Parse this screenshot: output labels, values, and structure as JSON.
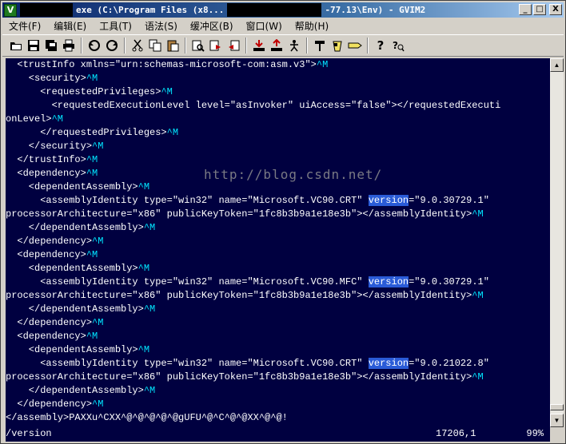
{
  "window": {
    "title_left": "exe (C:\\Program Files (x8...",
    "title_right": "-77.13\\Env) - GVIM2",
    "controls": {
      "minimize": "_",
      "maximize": "□",
      "close": "X"
    }
  },
  "menu": [
    "文件(F)",
    "编辑(E)",
    "工具(T)",
    "语法(S)",
    "缓冲区(B)",
    "窗口(W)",
    "帮助(H)"
  ],
  "toolbar": {
    "icons": [
      "open-icon",
      "save-icon",
      "save-all-icon",
      "print-icon",
      "undo-icon",
      "redo-icon",
      "cut-icon",
      "copy-icon",
      "paste-icon",
      "find-replace-icon",
      "find-next-icon",
      "find-prev-icon",
      "load-session-icon",
      "save-session-icon",
      "run-script-icon",
      "make-icon",
      "shell-icon",
      "tag-jump-icon",
      "help-icon",
      "find-help-icon"
    ]
  },
  "editor": {
    "lines": [
      [
        {
          "t": "  <trustInfo xmlns=\"urn:schemas-microsoft-com:asm.v3\">"
        },
        {
          "t": "^M",
          "c": "ctrl"
        }
      ],
      [
        {
          "t": "    <security>"
        },
        {
          "t": "^M",
          "c": "ctrl"
        }
      ],
      [
        {
          "t": "      <requestedPrivileges>"
        },
        {
          "t": "^M",
          "c": "ctrl"
        }
      ],
      [
        {
          "t": "        <requestedExecutionLevel level=\"asInvoker\" uiAccess=\"false\"></requestedExecuti"
        }
      ],
      [
        {
          "t": "onLevel>"
        },
        {
          "t": "^M",
          "c": "ctrl"
        }
      ],
      [
        {
          "t": "      </requestedPrivileges>"
        },
        {
          "t": "^M",
          "c": "ctrl"
        }
      ],
      [
        {
          "t": "    </security>"
        },
        {
          "t": "^M",
          "c": "ctrl"
        }
      ],
      [
        {
          "t": "  </trustInfo>"
        },
        {
          "t": "^M",
          "c": "ctrl"
        }
      ],
      [
        {
          "t": "  <dependency>"
        },
        {
          "t": "^M",
          "c": "ctrl"
        }
      ],
      [
        {
          "t": "    <dependentAssembly>"
        },
        {
          "t": "^M",
          "c": "ctrl"
        }
      ],
      [
        {
          "t": "      <assemblyIdentity type=\"win32\" name=\"Microsoft.VC90.CRT\" "
        },
        {
          "t": "version",
          "c": "hl"
        },
        {
          "t": "=\"9.0.30729.1\""
        }
      ],
      [
        {
          "t": "processorArchitecture=\"x86\" publicKeyToken=\"1fc8b3b9a1e18e3b\"></assemblyIdentity>"
        },
        {
          "t": "^M",
          "c": "ctrl"
        }
      ],
      [
        {
          "t": "    </dependentAssembly>"
        },
        {
          "t": "^M",
          "c": "ctrl"
        }
      ],
      [
        {
          "t": "  </dependency>"
        },
        {
          "t": "^M",
          "c": "ctrl"
        }
      ],
      [
        {
          "t": "  <dependency>"
        },
        {
          "t": "^M",
          "c": "ctrl"
        }
      ],
      [
        {
          "t": "    <dependentAssembly>"
        },
        {
          "t": "^M",
          "c": "ctrl"
        }
      ],
      [
        {
          "t": "      <assemblyIdentity type=\"win32\" name=\"Microsoft.VC90.MFC\" "
        },
        {
          "t": "version",
          "c": "hl"
        },
        {
          "t": "=\"9.0.30729.1\""
        }
      ],
      [
        {
          "t": "processorArchitecture=\"x86\" publicKeyToken=\"1fc8b3b9a1e18e3b\"></assemblyIdentity>"
        },
        {
          "t": "^M",
          "c": "ctrl"
        }
      ],
      [
        {
          "t": "    </dependentAssembly>"
        },
        {
          "t": "^M",
          "c": "ctrl"
        }
      ],
      [
        {
          "t": "  </dependency>"
        },
        {
          "t": "^M",
          "c": "ctrl"
        }
      ],
      [
        {
          "t": "  <dependency>"
        },
        {
          "t": "^M",
          "c": "ctrl"
        }
      ],
      [
        {
          "t": "    <dependentAssembly>"
        },
        {
          "t": "^M",
          "c": "ctrl"
        }
      ],
      [
        {
          "t": "      <assemblyIdentity type=\"win32\" name=\"Microsoft.VC90.CRT\" "
        },
        {
          "t": "version",
          "c": "hl"
        },
        {
          "t": "=\"9.0.21022.8\""
        }
      ],
      [
        {
          "t": "processorArchitecture=\"x86\" publicKeyToken=\"1fc8b3b9a1e18e3b\"></assemblyIdentity>"
        },
        {
          "t": "^M",
          "c": "ctrl"
        }
      ],
      [
        {
          "t": "    </dependentAssembly>"
        },
        {
          "t": "^M",
          "c": "ctrl"
        }
      ],
      [
        {
          "t": "  </dependency>"
        },
        {
          "t": "^M",
          "c": "ctrl"
        }
      ],
      [
        {
          "t": "</assembly>PAXXu^CXX^@^@^@^@^@gUFU^@^C^@^@XX^@^@!"
        }
      ]
    ],
    "watermark": "http://blog.csdn.net/"
  },
  "status": {
    "command": "/version",
    "position": "17206,1",
    "percent": "99%"
  },
  "colors": {
    "background": "#000040",
    "control_chars": "#00e6ff",
    "search_highlight": "#2a5bd7"
  }
}
